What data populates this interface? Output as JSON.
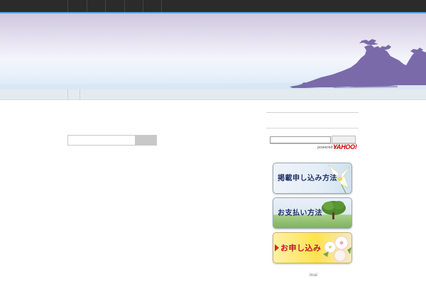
{
  "sidebar": {
    "yahoo_search": {
      "powered_text": "powered by",
      "logo_text": "YAHOO!",
      "button_label": ""
    },
    "buttons": [
      {
        "label": "掲載申し込み方法"
      },
      {
        "label": "お支払い方法"
      },
      {
        "label": "お申し込み"
      }
    ],
    "footer_text": "inui"
  },
  "colors": {
    "top_bar": "#2b2b2b",
    "accent_line": "#5aa6dd",
    "island": "#7a6aaa",
    "button_text": "#1f2f66",
    "apply_text": "#c2142a"
  }
}
